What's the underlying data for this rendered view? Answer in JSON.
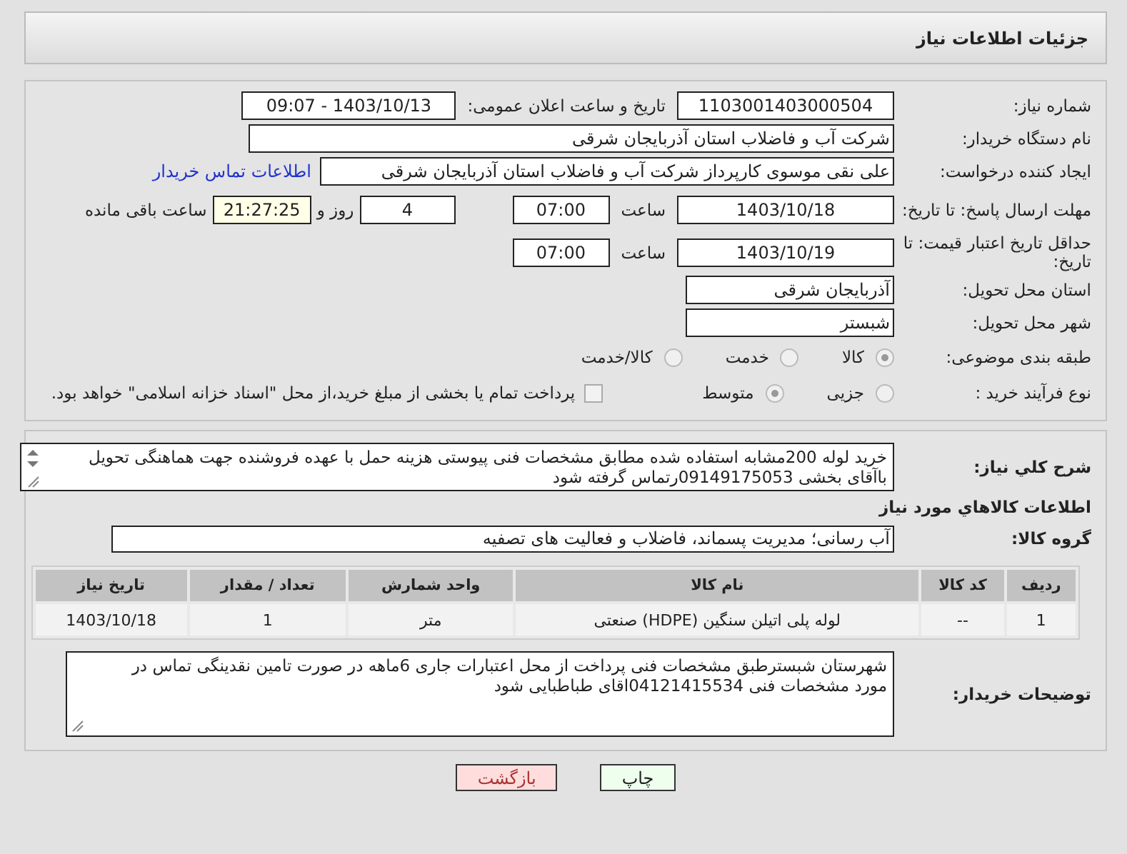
{
  "header": {
    "title": "جزئیات اطلاعات نیاز"
  },
  "fields": {
    "need_number": {
      "label": "شماره نیاز:",
      "value": "1103001403000504"
    },
    "announce": {
      "label": "تاریخ و ساعت اعلان عمومی:",
      "value": "1403/10/13 - 09:07"
    },
    "buyer": {
      "label": "نام دستگاه خریدار:",
      "value": "شرکت آب و فاضلاب استان آذربایجان شرقی"
    },
    "creator": {
      "label": "ایجاد کننده درخواست:",
      "value": "علی نقی موسوی کارپرداز شرکت آب و فاضلاب استان آذربایجان شرقی",
      "link": "اطلاعات تماس خریدار"
    },
    "deadline": {
      "label": "مهلت ارسال پاسخ: تا تاریخ:",
      "date": "1403/10/18",
      "time_label": "ساعت",
      "time": "07:00",
      "days": "4",
      "days_label": "روز و",
      "remaining": "21:27:25",
      "remaining_label": "ساعت باقی مانده"
    },
    "validity": {
      "label": "حداقل تاریخ اعتبار قیمت: تا تاریخ:",
      "date": "1403/10/19",
      "time_label": "ساعت",
      "time": "07:00"
    },
    "province": {
      "label": "استان محل تحویل:",
      "value": "آذربایجان شرقی"
    },
    "city": {
      "label": "شهر محل تحویل:",
      "value": "شبستر"
    },
    "category": {
      "label": "طبقه بندی موضوعی:",
      "options": [
        {
          "label": "كالا",
          "selected": true
        },
        {
          "label": "خدمت",
          "selected": false
        },
        {
          "label": "کالا/خدمت",
          "selected": false
        }
      ]
    },
    "process": {
      "label": "نوع فرآیند خرید :",
      "options": [
        {
          "label": "جزیی",
          "selected": false
        },
        {
          "label": "متوسط",
          "selected": true
        }
      ],
      "payment": {
        "label": "پرداخت تمام یا بخشی از مبلغ خرید،از محل \"اسناد خزانه اسلامی\" خواهد بود.",
        "checked": false
      }
    }
  },
  "description": {
    "label": "شرح كلي نياز:",
    "value": "خرید لوله 200مشابه استفاده شده مطابق مشخصات فنی پیوستی  هزینه حمل با عهده فروشنده جهت هماهنگی تحویل باآقای بخشی 09149175053رتماس گرفته شود"
  },
  "goods_heading": "اطلاعات كالاهاي مورد نياز",
  "group": {
    "label": "گروه کالا:",
    "value": "آب رسانی؛ مدیریت پسماند، فاضلاب و فعالیت های تصفیه"
  },
  "table": {
    "columns": [
      "ردیف",
      "کد کالا",
      "نام کالا",
      "واحد شمارش",
      "تعداد / مقدار",
      "تاریخ نیاز"
    ],
    "rows": [
      [
        "1",
        "--",
        "لوله پلی اتیلن سنگین (HDPE) صنعتی",
        "متر",
        "1",
        "1403/10/18"
      ]
    ]
  },
  "notes": {
    "label": "توضیحات خریدار:",
    "value": "شهرستان شبسترطبق مشخصات فنی پرداخت از محل اعتبارات جاری  6ماهه در صورت تامین نقدینگی تماس در مورد مشخصات فنی 04121415534اقای  طباطبایی  شود"
  },
  "buttons": [
    {
      "label": "چاپ",
      "kind": "print"
    },
    {
      "label": "بازگشت",
      "kind": "back"
    }
  ]
}
